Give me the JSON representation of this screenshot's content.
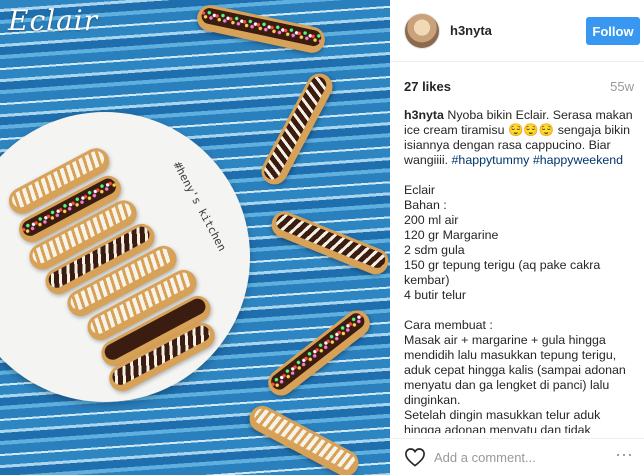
{
  "photo": {
    "title": "Eclair",
    "watermark": "#heny's kitchen"
  },
  "post": {
    "username": "h3nyta",
    "follow_label": "Follow",
    "likes": "27 likes",
    "age": "55w",
    "caption_lines": [
      {
        "parts": [
          {
            "t": "h3nyta",
            "k": "owner"
          },
          {
            "t": " Nyoba bikin Eclair. Serasa makan",
            "k": "text"
          }
        ]
      },
      {
        "parts": [
          {
            "t": "ice cream tiramisu 😌😌😌 sengaja bikin",
            "k": "text"
          }
        ]
      },
      {
        "parts": [
          {
            "t": "isiannya dengan rasa cappucino. Biar",
            "k": "text"
          }
        ]
      },
      {
        "parts": [
          {
            "t": "wangiiii. ",
            "k": "text"
          },
          {
            "t": "#happytummy",
            "k": "tag"
          },
          {
            "t": " ",
            "k": "text"
          },
          {
            "t": "#happyweekend",
            "k": "tag"
          }
        ]
      },
      {
        "parts": []
      },
      {
        "parts": [
          {
            "t": "Eclair",
            "k": "text"
          }
        ]
      },
      {
        "parts": [
          {
            "t": "Bahan :",
            "k": "text"
          }
        ]
      },
      {
        "parts": [
          {
            "t": "200 ml air",
            "k": "text"
          }
        ]
      },
      {
        "parts": [
          {
            "t": "120 gr Margarine",
            "k": "text"
          }
        ]
      },
      {
        "parts": [
          {
            "t": "2 sdm gula",
            "k": "text"
          }
        ]
      },
      {
        "parts": [
          {
            "t": "150 gr tepung terigu (aq pake cakra",
            "k": "text"
          }
        ]
      },
      {
        "parts": [
          {
            "t": "kembar)",
            "k": "text"
          }
        ]
      },
      {
        "parts": [
          {
            "t": "4 butir telur",
            "k": "text"
          }
        ]
      },
      {
        "parts": []
      },
      {
        "parts": [
          {
            "t": "Cara membuat :",
            "k": "text"
          }
        ]
      },
      {
        "parts": [
          {
            "t": "Masak air + margarine + gula hingga",
            "k": "text"
          }
        ]
      },
      {
        "parts": [
          {
            "t": "mendidih lalu masukkan tepung terigu,",
            "k": "text"
          }
        ]
      },
      {
        "parts": [
          {
            "t": "aduk cepat hingga kalis (sampai adonan",
            "k": "text"
          }
        ]
      },
      {
        "parts": [
          {
            "t": "menyatu dan ga lengket di panci) lalu",
            "k": "text"
          }
        ]
      },
      {
        "parts": [
          {
            "t": "dinginkan.",
            "k": "text"
          }
        ]
      },
      {
        "parts": [
          {
            "t": "Setelah dingin masukkan telur aduk",
            "k": "text"
          }
        ]
      },
      {
        "parts": [
          {
            "t": "hingga adonan menyatu dan tidak",
            "k": "text"
          }
        ]
      }
    ]
  },
  "comment": {
    "placeholder": "Add a comment..."
  },
  "icons": {
    "like": "heart-icon",
    "more": "more-options-icon"
  },
  "colors": {
    "follow_button": "#3897f0",
    "hashtag": "#003569",
    "muted_text": "#999999"
  }
}
